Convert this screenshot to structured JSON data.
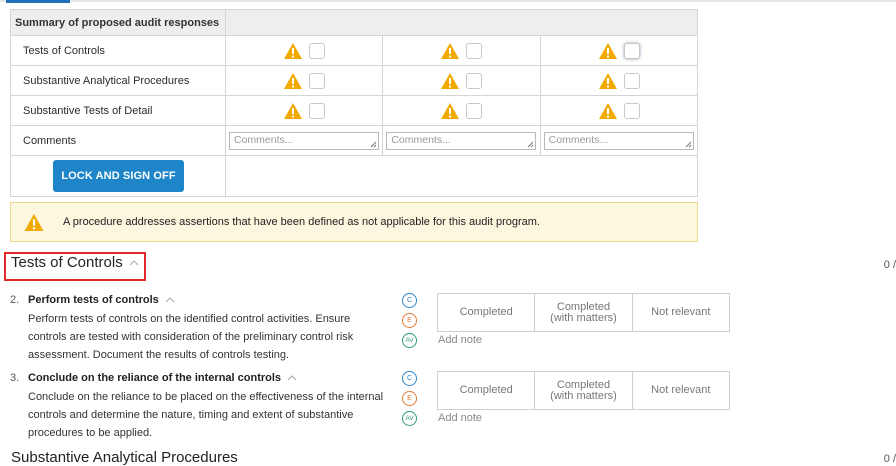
{
  "summary": {
    "header": "Summary of proposed audit responses",
    "rows": [
      {
        "label": "Tests of Controls"
      },
      {
        "label": "Substantive Analytical Procedures"
      },
      {
        "label": "Substantive Tests of Detail"
      }
    ],
    "comments_label": "Comments",
    "comments_placeholder": "Comments...",
    "lock_button": "LOCK AND SIGN OFF"
  },
  "banner": {
    "text": "A procedure addresses assertions that have been defined as not applicable for this audit program."
  },
  "section_tests": {
    "title": "Tests of Controls",
    "count": "0 /"
  },
  "procedures": [
    {
      "number": "2.",
      "title": "Perform tests of controls",
      "description": "Perform tests of controls on the identified control activities. Ensure controls are tested with consideration of the preliminary control risk assessment. Document the results of controls testing.",
      "badges": [
        "C",
        "E",
        "AV"
      ],
      "options": [
        "Completed",
        "Completed (with matters)",
        "Not relevant"
      ],
      "add_note": "Add note"
    },
    {
      "number": "3.",
      "title": "Conclude on the reliance of the internal controls",
      "description": "Conclude on the reliance to be placed on the effectiveness of the internal controls and determine the nature, timing and extent of substantive procedures to be applied.",
      "badges": [
        "C",
        "E",
        "AV"
      ],
      "options": [
        "Completed",
        "Completed (with matters)",
        "Not relevant"
      ],
      "add_note": "Add note"
    }
  ],
  "section_substantive": {
    "title": "Substantive Analytical Procedures",
    "count": "0 /"
  },
  "colors": {
    "warning": "#f2a900",
    "button": "#1e85c9",
    "highlight_box": "#e02a2a"
  }
}
